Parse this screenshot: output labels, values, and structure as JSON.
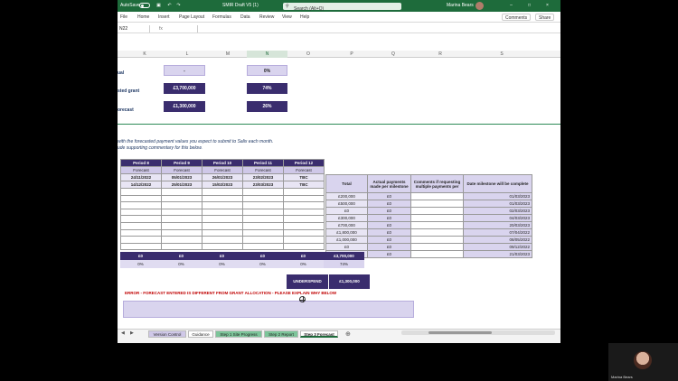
{
  "title_bar": {
    "autosave": "AutoSave",
    "autosave_state": "OFF",
    "file_name": "SMIR Draft V5 (1)",
    "search": "Search (Alt+Q)",
    "user": "Marina Bears"
  },
  "ribbon": {
    "menus": [
      "File",
      "Home",
      "Insert",
      "Page Layout",
      "Formulas",
      "Data",
      "Review",
      "View",
      "Help"
    ],
    "comments": "Comments",
    "share": "Share"
  },
  "formula_bar": {
    "name_box": "N22",
    "fx": "fx"
  },
  "columns": [
    "K",
    "L",
    "M",
    "N",
    "O",
    "P",
    "Q",
    "R",
    "S"
  ],
  "top_section": {
    "rows": [
      {
        "num": "",
        "label": "ual",
        "value_l": "-",
        "value_n": "0%"
      },
      {
        "num": "",
        "label": "sted grant",
        "value_l": "£3,700,000",
        "value_n": "74%"
      },
      {
        "num": "",
        "label": "orecast",
        "value_l": "£1,300,000",
        "value_n": "26%"
      }
    ]
  },
  "instructions": {
    "line1": "with the forecasted payment values you expect to submit to Salix each month.",
    "line2": "ude supporting commentary for this below."
  },
  "periods": {
    "headers": [
      "Period 8",
      "Period 9",
      "Period 10",
      "Period 11",
      "Period 12"
    ],
    "forecast": [
      "Forecast",
      "Forecast",
      "Forecast",
      "Forecast",
      "Forecast"
    ],
    "row1": [
      "24/11/2022",
      "05/01/2023",
      "26/01/2023",
      "23/02/2023",
      "TBC"
    ],
    "row2": [
      "14/12/2022",
      "25/01/2023",
      "15/02/2023",
      "23/03/2023",
      "TBC"
    ]
  },
  "milestones": {
    "headers": [
      "Total",
      "Actual payments made per milestone",
      "Comments if requesting multiple payments per",
      "Date milestone will be complete"
    ],
    "rows": [
      [
        "£200,000",
        "£0",
        "",
        "01/03/2023"
      ],
      [
        "£500,000",
        "£0",
        "",
        "01/03/2023"
      ],
      [
        "£0",
        "£0",
        "",
        "02/03/2023"
      ],
      [
        "£300,000",
        "£0",
        "",
        "04/03/2023"
      ],
      [
        "£700,000",
        "£0",
        "",
        "20/03/2023"
      ],
      [
        "£1,800,000",
        "£0",
        "",
        "07/04/2022"
      ],
      [
        "£1,000,000",
        "£0",
        "",
        "08/05/2022"
      ],
      [
        "£0",
        "£0",
        "",
        "09/12/2022"
      ],
      [
        "£0",
        "£0",
        "",
        "21/03/2023"
      ]
    ]
  },
  "totals": {
    "amounts": [
      "£0",
      "£0",
      "£0",
      "£0",
      "£0",
      "£3,700,000"
    ],
    "percents": [
      "0%",
      "0%",
      "0%",
      "0%",
      "0%",
      "74%"
    ],
    "underspend_label": "UNDERSPEND",
    "underspend_value": "£1,300,000"
  },
  "error_text": "ERROR - FORECAST ENTERED IS DIFFERENT FROM GRANT ALLOCATION - PLEASE EXPLAIN WHY BELOW",
  "sheet_tabs": [
    "Version Control",
    "Guidance",
    "Step 1 Site Progress",
    "Step 2 Report",
    "Step 3 Forecast"
  ],
  "webcam_name": "Marina Bears"
}
